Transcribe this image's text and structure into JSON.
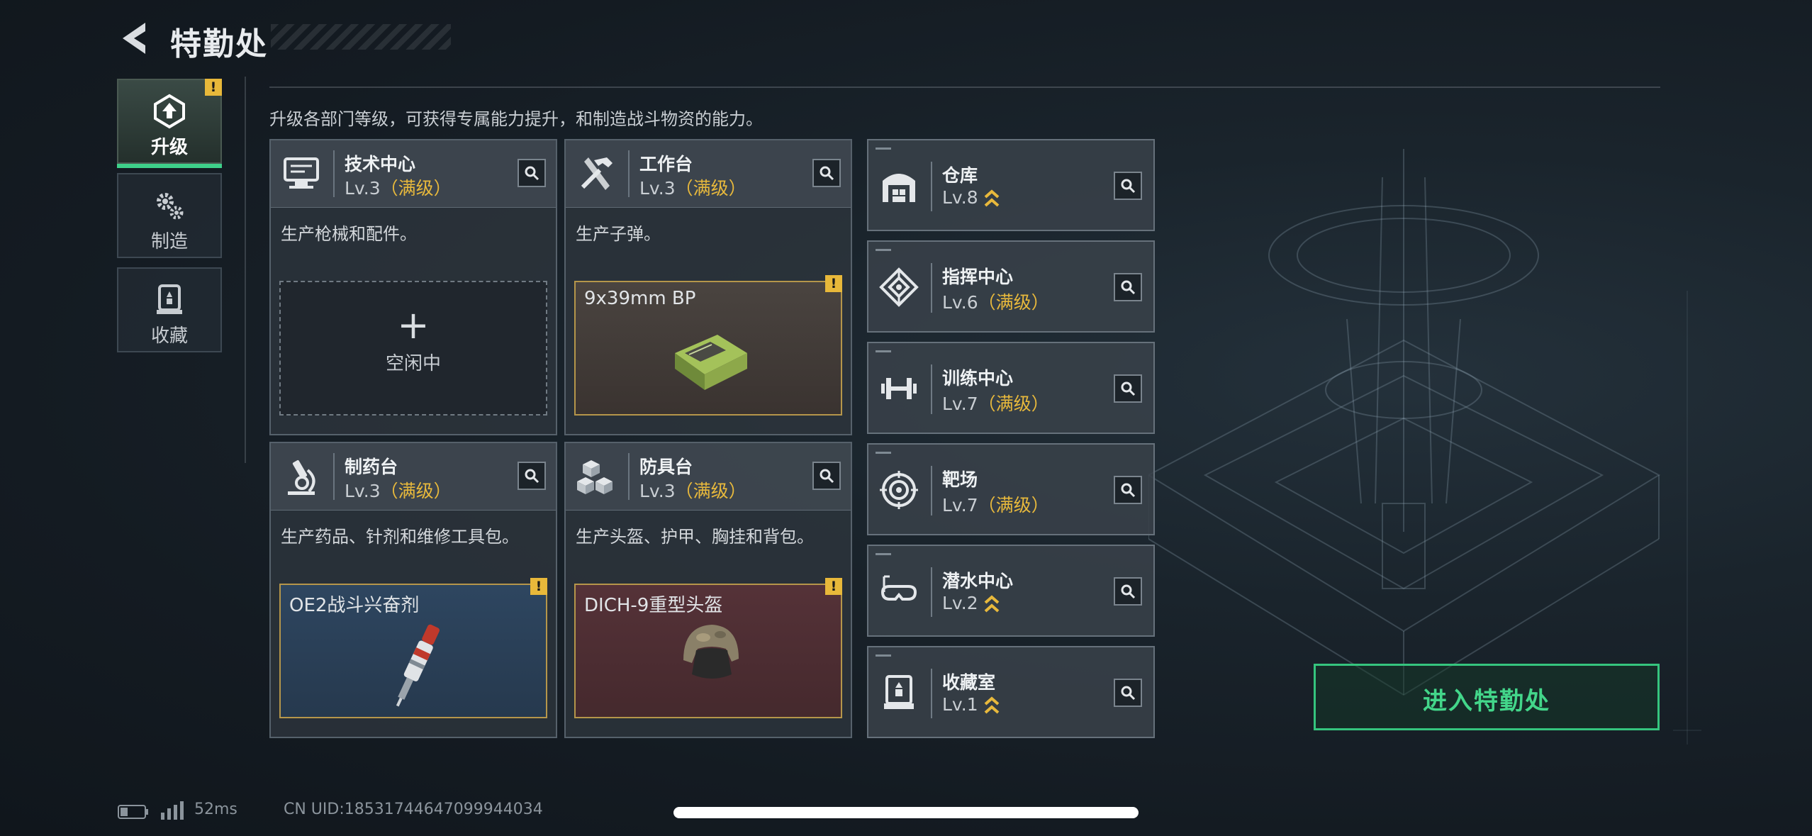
{
  "header": {
    "title": "特勤处",
    "back_icon": "back-arrow-icon"
  },
  "tabs": [
    {
      "label": "升级",
      "icon": "upgrade-icon",
      "active": true,
      "badge": "!"
    },
    {
      "label": "制造",
      "icon": "gears-icon",
      "active": false
    },
    {
      "label": "收藏",
      "icon": "collection-icon",
      "active": false
    }
  ],
  "intro": "升级各部门等级，可获得专属能力提升，和制造战斗物资的能力。",
  "production": [
    {
      "name": "技术中心",
      "level": "Lv.3",
      "status": "（满级）",
      "icon": "computer-icon",
      "desc": "生产枪械和配件。",
      "slot": {
        "type": "idle",
        "plus": "+",
        "label": "空闲中"
      }
    },
    {
      "name": "工作台",
      "level": "Lv.3",
      "status": "（满级）",
      "icon": "tools-icon",
      "desc": "生产子弹。",
      "slot": {
        "type": "item",
        "name": "9x39mm BP",
        "badge": "!",
        "icon": "ammo-box-icon"
      }
    },
    {
      "name": "制药台",
      "level": "Lv.3",
      "status": "（满级）",
      "icon": "microscope-icon",
      "desc": "生产药品、针剂和维修工具包。",
      "slot": {
        "type": "item",
        "name": "OE2战斗兴奋剂",
        "badge": "!",
        "icon": "injector-icon"
      }
    },
    {
      "name": "防具台",
      "level": "Lv.3",
      "status": "（满级）",
      "icon": "armor-boxes-icon",
      "desc": "生产头盔、护甲、胸挂和背包。",
      "slot": {
        "type": "item",
        "name": "DICH-9重型头盔",
        "badge": "!",
        "icon": "helmet-icon"
      }
    }
  ],
  "facilities": [
    {
      "name": "仓库",
      "level": "Lv.8",
      "status": "",
      "upgradable": true,
      "icon": "warehouse-icon"
    },
    {
      "name": "指挥中心",
      "level": "Lv.6",
      "status": "（满级）",
      "upgradable": false,
      "icon": "command-icon"
    },
    {
      "name": "训练中心",
      "level": "Lv.7",
      "status": "（满级）",
      "upgradable": false,
      "icon": "dumbbell-icon"
    },
    {
      "name": "靶场",
      "level": "Lv.7",
      "status": "（满级）",
      "upgradable": false,
      "icon": "target-icon"
    },
    {
      "name": "潜水中心",
      "level": "Lv.2",
      "status": "",
      "upgradable": true,
      "icon": "dive-mask-icon"
    },
    {
      "name": "收藏室",
      "level": "Lv.1",
      "status": "",
      "upgradable": true,
      "icon": "trophy-case-icon"
    }
  ],
  "enter_button": "进入特勤处",
  "status_bar": {
    "ping": "52ms",
    "uid": "CN UID:18531744647099944034"
  },
  "colors": {
    "accent": "#3ed08a",
    "max_level": "#e8b93c",
    "badge": "#e8b83a"
  }
}
